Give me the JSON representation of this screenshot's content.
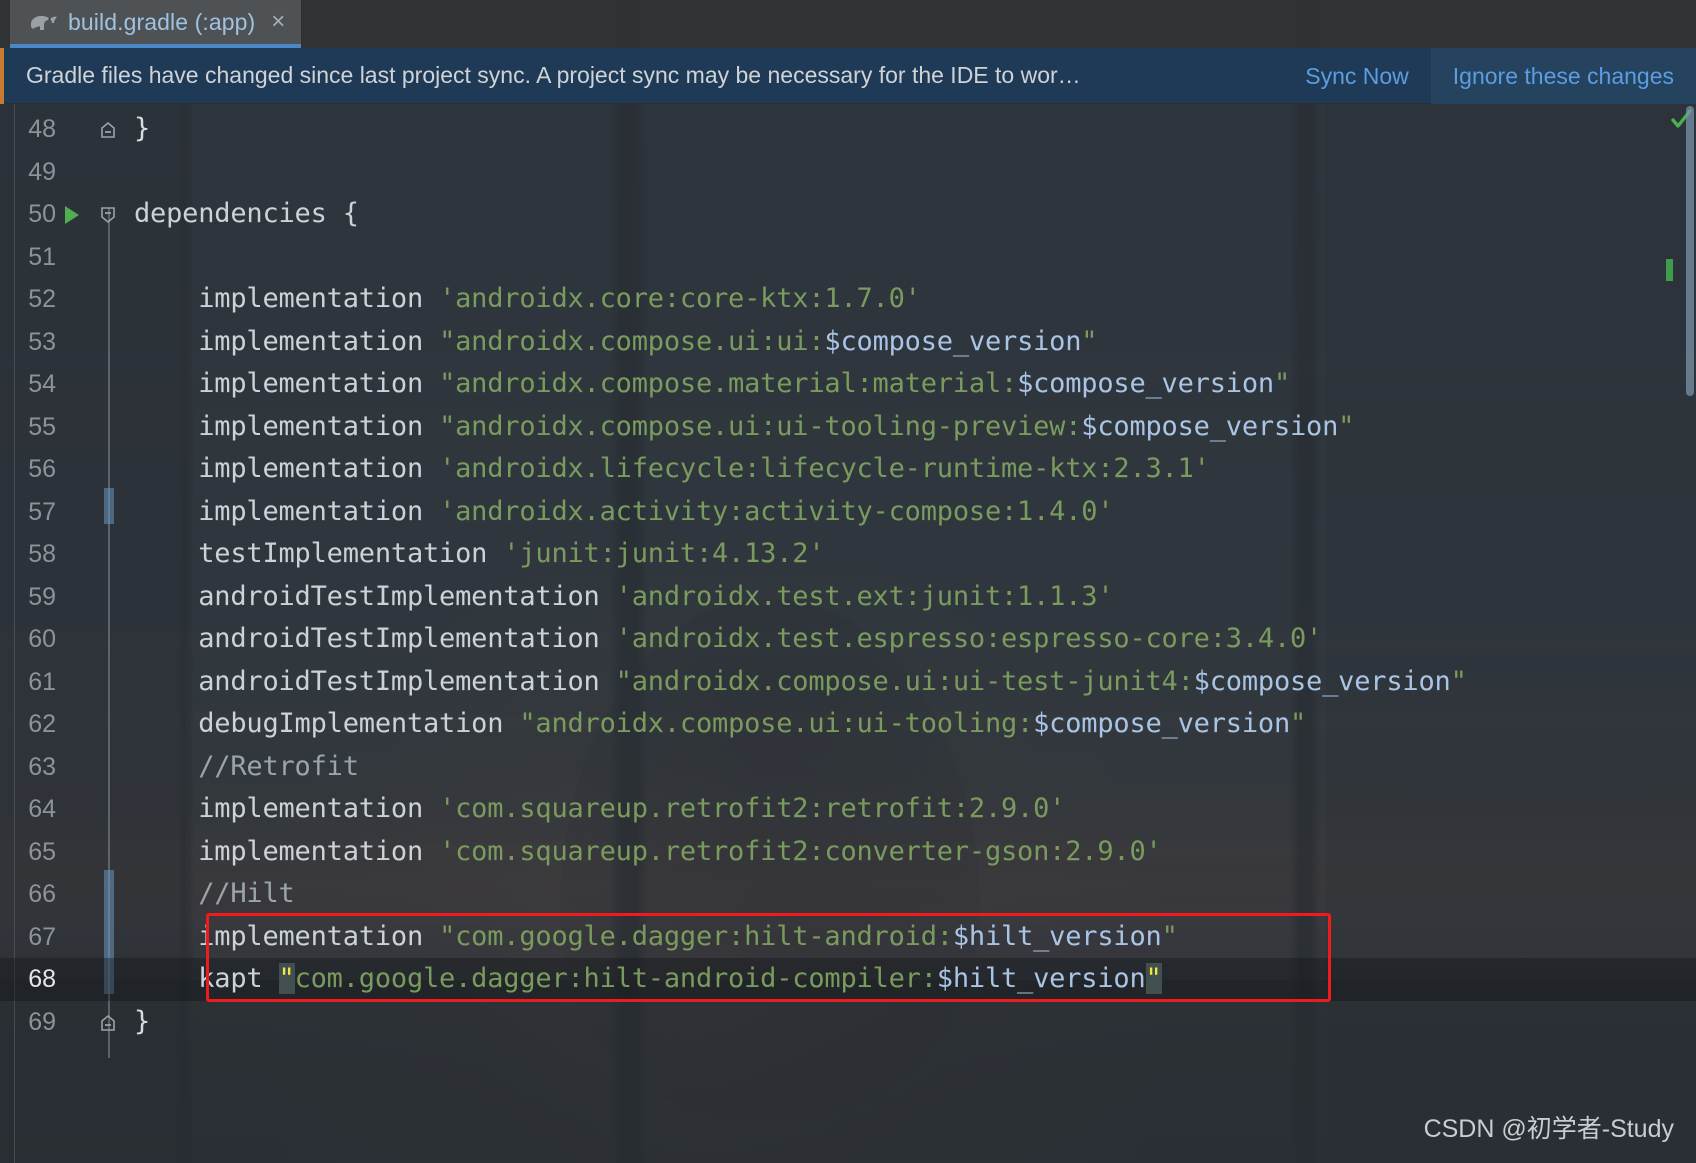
{
  "window": {
    "title": "build.gradle (:app)"
  },
  "tab": {
    "label": "build.gradle (:app)",
    "close_label": "×",
    "icon": "gradle-elephant-icon",
    "accent_color": "#4a88c7"
  },
  "banner": {
    "message": "Gradle files have changed since last project sync. A project sync may be necessary for the IDE to wor…",
    "sync_label": "Sync Now",
    "ignore_label": "Ignore these changes",
    "background": "#1f3a57",
    "link_color": "#5b9ee0"
  },
  "editor": {
    "language": "groovy",
    "font_size_px": 27,
    "colors": {
      "keyword": "#cbd3d8",
      "string": "#7a9b5e",
      "variable": "#a9c4e4",
      "comment": "#9aa4ab",
      "quote_highlight_fg": "#f5e642",
      "quote_highlight_bg": "#41504e",
      "annotation_box": "#ee1c1c",
      "gutter_number": "#8d9499",
      "current_line_number": "#e3e6e8"
    },
    "lines": [
      {
        "n": "48",
        "fold": "end",
        "tokens": [
          {
            "t": "brc",
            "v": "}"
          }
        ]
      },
      {
        "n": "49",
        "tokens": []
      },
      {
        "n": "50",
        "run": true,
        "fold": "start",
        "tokens": [
          {
            "t": "kw",
            "v": "dependencies {"
          }
        ]
      },
      {
        "n": "51",
        "tokens": []
      },
      {
        "n": "52",
        "tokens": [
          {
            "t": "kw",
            "v": "    implementation "
          },
          {
            "t": "str",
            "v": "'androidx.core:core-ktx:1.7.0'"
          }
        ]
      },
      {
        "n": "53",
        "tokens": [
          {
            "t": "kw",
            "v": "    implementation "
          },
          {
            "t": "str",
            "v": "\"androidx.compose.ui:ui:"
          },
          {
            "t": "var",
            "v": "$compose_version"
          },
          {
            "t": "str",
            "v": "\""
          }
        ]
      },
      {
        "n": "54",
        "tokens": [
          {
            "t": "kw",
            "v": "    implementation "
          },
          {
            "t": "str",
            "v": "\"androidx.compose.material:material:"
          },
          {
            "t": "var",
            "v": "$compose_version"
          },
          {
            "t": "str",
            "v": "\""
          }
        ]
      },
      {
        "n": "55",
        "tokens": [
          {
            "t": "kw",
            "v": "    implementation "
          },
          {
            "t": "str",
            "v": "\"androidx.compose.ui:ui-tooling-preview:"
          },
          {
            "t": "var",
            "v": "$compose_version"
          },
          {
            "t": "str",
            "v": "\""
          }
        ]
      },
      {
        "n": "56",
        "tokens": [
          {
            "t": "kw",
            "v": "    implementation "
          },
          {
            "t": "str",
            "v": "'androidx.lifecycle:lifecycle-runtime-ktx:2.3.1'"
          }
        ]
      },
      {
        "n": "57",
        "tokens": [
          {
            "t": "kw",
            "v": "    implementation "
          },
          {
            "t": "str",
            "v": "'androidx.activity:activity-compose:1.4.0'"
          }
        ]
      },
      {
        "n": "58",
        "tokens": [
          {
            "t": "kw",
            "v": "    testImplementation "
          },
          {
            "t": "str",
            "v": "'junit:junit:4.13.2'"
          }
        ]
      },
      {
        "n": "59",
        "tokens": [
          {
            "t": "kw",
            "v": "    androidTestImplementation "
          },
          {
            "t": "str",
            "v": "'androidx.test.ext:junit:1.1.3'"
          }
        ]
      },
      {
        "n": "60",
        "tokens": [
          {
            "t": "kw",
            "v": "    androidTestImplementation "
          },
          {
            "t": "str",
            "v": "'androidx.test.espresso:espresso-core:3.4.0'"
          }
        ]
      },
      {
        "n": "61",
        "tokens": [
          {
            "t": "kw",
            "v": "    androidTestImplementation "
          },
          {
            "t": "str",
            "v": "\"androidx.compose.ui:ui-test-junit4:"
          },
          {
            "t": "var",
            "v": "$compose_version"
          },
          {
            "t": "str",
            "v": "\""
          }
        ]
      },
      {
        "n": "62",
        "tokens": [
          {
            "t": "kw",
            "v": "    debugImplementation "
          },
          {
            "t": "str",
            "v": "\"androidx.compose.ui:ui-tooling:"
          },
          {
            "t": "var",
            "v": "$compose_version"
          },
          {
            "t": "str",
            "v": "\""
          }
        ]
      },
      {
        "n": "63",
        "tokens": [
          {
            "t": "cmt",
            "v": "    //Retrofit"
          }
        ]
      },
      {
        "n": "64",
        "tokens": [
          {
            "t": "kw",
            "v": "    implementation "
          },
          {
            "t": "str",
            "v": "'com.squareup.retrofit2:retrofit:2.9.0'"
          }
        ]
      },
      {
        "n": "65",
        "tokens": [
          {
            "t": "kw",
            "v": "    implementation "
          },
          {
            "t": "str",
            "v": "'com.squareup.retrofit2:converter-gson:2.9.0'"
          }
        ]
      },
      {
        "n": "66",
        "tokens": [
          {
            "t": "cmt",
            "v": "    //Hilt"
          }
        ]
      },
      {
        "n": "67",
        "boxed": true,
        "tokens": [
          {
            "t": "kw",
            "v": "    implementation "
          },
          {
            "t": "str",
            "v": "\"com.google.dagger:hilt-android:"
          },
          {
            "t": "var",
            "v": "$hilt_version"
          },
          {
            "t": "str",
            "v": "\""
          }
        ]
      },
      {
        "n": "68",
        "current": true,
        "boxed": true,
        "tokens": [
          {
            "t": "kw",
            "v": "    kapt "
          },
          {
            "t": "qhl",
            "v": "\""
          },
          {
            "t": "str",
            "v": "com.google.dagger:hilt-android-compiler:"
          },
          {
            "t": "var",
            "v": "$hilt_version"
          },
          {
            "t": "qhl",
            "v": "\""
          }
        ]
      },
      {
        "n": "69",
        "fold": "end",
        "tokens": [
          {
            "t": "brc",
            "v": "}"
          }
        ]
      }
    ]
  },
  "inspection": {
    "status_icon": "green-check-icon",
    "status_color": "#4caf50"
  },
  "watermark": {
    "text": "CSDN @初学者-Study"
  }
}
